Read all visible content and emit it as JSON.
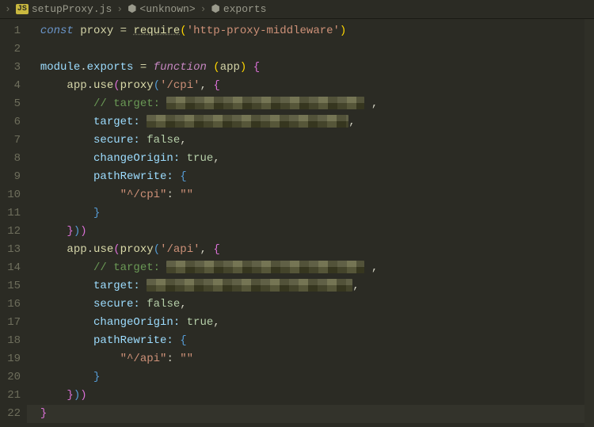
{
  "breadcrumb": {
    "file": "setupProxy.js",
    "sym1": "<unknown>",
    "sym2": "exports"
  },
  "lineNumbers": [
    "1",
    "2",
    "3",
    "4",
    "5",
    "6",
    "7",
    "8",
    "9",
    "10",
    "11",
    "12",
    "13",
    "14",
    "15",
    "16",
    "17",
    "18",
    "19",
    "20",
    "21",
    "22"
  ],
  "tokens": {
    "const": "const",
    "proxy": "proxy",
    "eq": " = ",
    "require": "require",
    "httpProxy": "'http-proxy-middleware'",
    "module": "module",
    "dot": ".",
    "exports": "exports",
    "function": "function",
    "app": "app",
    "use": "use",
    "cpiPath": "'/cpi'",
    "apiPath": "'/api'",
    "targetCmt": "// target:",
    "target": "target:",
    "secure": "secure:",
    "changeOrigin": "changeOrigin:",
    "pathRewrite": "pathRewrite:",
    "cpiKey": "\"^/cpi\"",
    "apiKey": "\"^/api\"",
    "empty": "\"\"",
    "false": "false",
    "true": "true",
    "comma": ","
  }
}
